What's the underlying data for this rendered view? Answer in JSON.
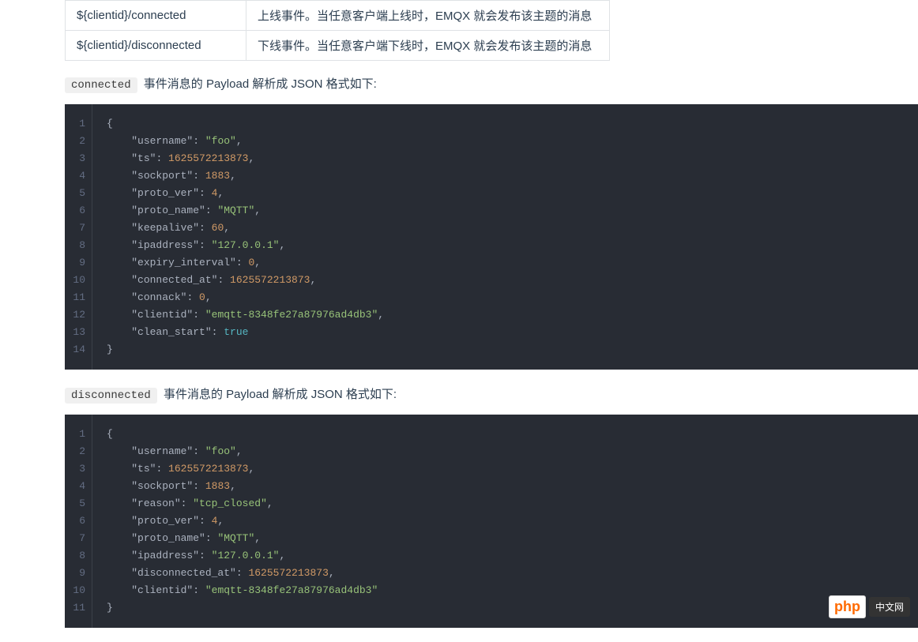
{
  "table": {
    "rows": [
      {
        "key": "${clientid}/connected",
        "desc": "上线事件。当任意客户端上线时，EMQX 就会发布该主题的消息"
      },
      {
        "key": "${clientid}/disconnected",
        "desc": "下线事件。当任意客户端下线时，EMQX 就会发布该主题的消息"
      }
    ]
  },
  "section1": {
    "tag": "connected",
    "text": "事件消息的 Payload 解析成 JSON 格式如下:",
    "code": [
      [
        {
          "t": "brace",
          "v": "{"
        }
      ],
      [
        {
          "t": "indent",
          "v": "    "
        },
        {
          "t": "key",
          "v": "\"username\""
        },
        {
          "t": "colon",
          "v": ": "
        },
        {
          "t": "str",
          "v": "\"foo\""
        },
        {
          "t": "comma",
          "v": ","
        }
      ],
      [
        {
          "t": "indent",
          "v": "    "
        },
        {
          "t": "key",
          "v": "\"ts\""
        },
        {
          "t": "colon",
          "v": ": "
        },
        {
          "t": "num",
          "v": "1625572213873"
        },
        {
          "t": "comma",
          "v": ","
        }
      ],
      [
        {
          "t": "indent",
          "v": "    "
        },
        {
          "t": "key",
          "v": "\"sockport\""
        },
        {
          "t": "colon",
          "v": ": "
        },
        {
          "t": "num",
          "v": "1883"
        },
        {
          "t": "comma",
          "v": ","
        }
      ],
      [
        {
          "t": "indent",
          "v": "    "
        },
        {
          "t": "key",
          "v": "\"proto_ver\""
        },
        {
          "t": "colon",
          "v": ": "
        },
        {
          "t": "num",
          "v": "4"
        },
        {
          "t": "comma",
          "v": ","
        }
      ],
      [
        {
          "t": "indent",
          "v": "    "
        },
        {
          "t": "key",
          "v": "\"proto_name\""
        },
        {
          "t": "colon",
          "v": ": "
        },
        {
          "t": "str",
          "v": "\"MQTT\""
        },
        {
          "t": "comma",
          "v": ","
        }
      ],
      [
        {
          "t": "indent",
          "v": "    "
        },
        {
          "t": "key",
          "v": "\"keepalive\""
        },
        {
          "t": "colon",
          "v": ": "
        },
        {
          "t": "num",
          "v": "60"
        },
        {
          "t": "comma",
          "v": ","
        }
      ],
      [
        {
          "t": "indent",
          "v": "    "
        },
        {
          "t": "key",
          "v": "\"ipaddress\""
        },
        {
          "t": "colon",
          "v": ": "
        },
        {
          "t": "str",
          "v": "\"127.0.0.1\""
        },
        {
          "t": "comma",
          "v": ","
        }
      ],
      [
        {
          "t": "indent",
          "v": "    "
        },
        {
          "t": "key",
          "v": "\"expiry_interval\""
        },
        {
          "t": "colon",
          "v": ": "
        },
        {
          "t": "num",
          "v": "0"
        },
        {
          "t": "comma",
          "v": ","
        }
      ],
      [
        {
          "t": "indent",
          "v": "    "
        },
        {
          "t": "key",
          "v": "\"connected_at\""
        },
        {
          "t": "colon",
          "v": ": "
        },
        {
          "t": "num",
          "v": "1625572213873"
        },
        {
          "t": "comma",
          "v": ","
        }
      ],
      [
        {
          "t": "indent",
          "v": "    "
        },
        {
          "t": "key",
          "v": "\"connack\""
        },
        {
          "t": "colon",
          "v": ": "
        },
        {
          "t": "num",
          "v": "0"
        },
        {
          "t": "comma",
          "v": ","
        }
      ],
      [
        {
          "t": "indent",
          "v": "    "
        },
        {
          "t": "key",
          "v": "\"clientid\""
        },
        {
          "t": "colon",
          "v": ": "
        },
        {
          "t": "str",
          "v": "\"emqtt-8348fe27a87976ad4db3\""
        },
        {
          "t": "comma",
          "v": ","
        }
      ],
      [
        {
          "t": "indent",
          "v": "    "
        },
        {
          "t": "key",
          "v": "\"clean_start\""
        },
        {
          "t": "colon",
          "v": ": "
        },
        {
          "t": "bool",
          "v": "true"
        }
      ],
      [
        {
          "t": "brace",
          "v": "}"
        }
      ]
    ]
  },
  "section2": {
    "tag": "disconnected",
    "text": "事件消息的 Payload 解析成 JSON 格式如下:",
    "code": [
      [
        {
          "t": "brace",
          "v": "{"
        }
      ],
      [
        {
          "t": "indent",
          "v": "    "
        },
        {
          "t": "key",
          "v": "\"username\""
        },
        {
          "t": "colon",
          "v": ": "
        },
        {
          "t": "str",
          "v": "\"foo\""
        },
        {
          "t": "comma",
          "v": ","
        }
      ],
      [
        {
          "t": "indent",
          "v": "    "
        },
        {
          "t": "key",
          "v": "\"ts\""
        },
        {
          "t": "colon",
          "v": ": "
        },
        {
          "t": "num",
          "v": "1625572213873"
        },
        {
          "t": "comma",
          "v": ","
        }
      ],
      [
        {
          "t": "indent",
          "v": "    "
        },
        {
          "t": "key",
          "v": "\"sockport\""
        },
        {
          "t": "colon",
          "v": ": "
        },
        {
          "t": "num",
          "v": "1883"
        },
        {
          "t": "comma",
          "v": ","
        }
      ],
      [
        {
          "t": "indent",
          "v": "    "
        },
        {
          "t": "key",
          "v": "\"reason\""
        },
        {
          "t": "colon",
          "v": ": "
        },
        {
          "t": "str",
          "v": "\"tcp_closed\""
        },
        {
          "t": "comma",
          "v": ","
        }
      ],
      [
        {
          "t": "indent",
          "v": "    "
        },
        {
          "t": "key",
          "v": "\"proto_ver\""
        },
        {
          "t": "colon",
          "v": ": "
        },
        {
          "t": "num",
          "v": "4"
        },
        {
          "t": "comma",
          "v": ","
        }
      ],
      [
        {
          "t": "indent",
          "v": "    "
        },
        {
          "t": "key",
          "v": "\"proto_name\""
        },
        {
          "t": "colon",
          "v": ": "
        },
        {
          "t": "str",
          "v": "\"MQTT\""
        },
        {
          "t": "comma",
          "v": ","
        }
      ],
      [
        {
          "t": "indent",
          "v": "    "
        },
        {
          "t": "key",
          "v": "\"ipaddress\""
        },
        {
          "t": "colon",
          "v": ": "
        },
        {
          "t": "str",
          "v": "\"127.0.0.1\""
        },
        {
          "t": "comma",
          "v": ","
        }
      ],
      [
        {
          "t": "indent",
          "v": "    "
        },
        {
          "t": "key",
          "v": "\"disconnected_at\""
        },
        {
          "t": "colon",
          "v": ": "
        },
        {
          "t": "num",
          "v": "1625572213873"
        },
        {
          "t": "comma",
          "v": ","
        }
      ],
      [
        {
          "t": "indent",
          "v": "    "
        },
        {
          "t": "key",
          "v": "\"clientid\""
        },
        {
          "t": "colon",
          "v": ": "
        },
        {
          "t": "str",
          "v": "\"emqtt-8348fe27a87976ad4db3\""
        }
      ],
      [
        {
          "t": "brace",
          "v": "}"
        }
      ]
    ]
  },
  "watermark": {
    "php": "php",
    "cn": "中文网"
  }
}
